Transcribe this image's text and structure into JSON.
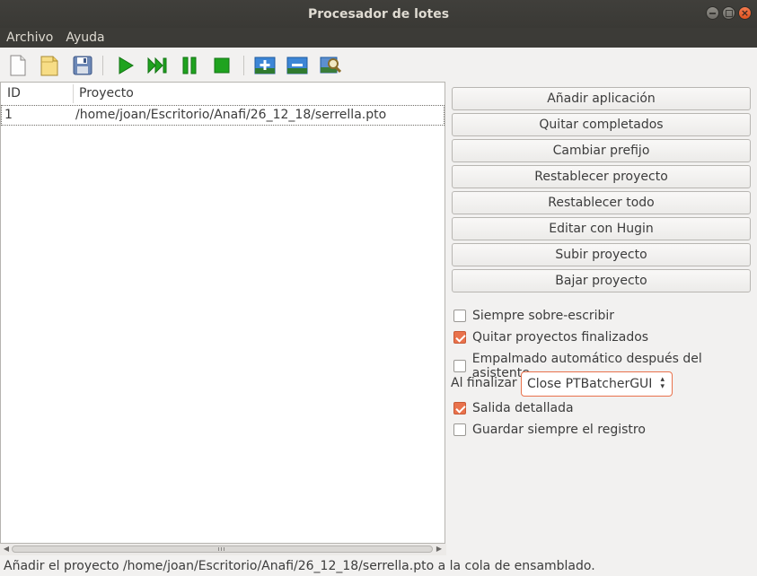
{
  "window": {
    "title": "Procesador de lotes"
  },
  "menu": [
    "Archivo",
    "Ayuda"
  ],
  "toolbar": {
    "icons": [
      "new-batch-icon",
      "open-batch-icon",
      "save-batch-icon",
      "start-icon",
      "skip-icon",
      "pause-icon",
      "stop-icon",
      "add-project-icon",
      "remove-project-icon",
      "search-projects-icon"
    ],
    "colors": {
      "play": "#1fa31f",
      "accent": "#e9724c"
    }
  },
  "table": {
    "columns": [
      "ID",
      "Proyecto"
    ],
    "rows": [
      {
        "id": "1",
        "project": "/home/joan/Escritorio/Anafi/26_12_18/serrella.pto"
      }
    ]
  },
  "buttons": [
    "Añadir aplicación",
    "Quitar completados",
    "Cambiar prefijo",
    "Restablecer proyecto",
    "Restablecer todo",
    "Editar con Hugin",
    "Subir proyecto",
    "Bajar proyecto"
  ],
  "options": {
    "overwrite": {
      "label": "Siempre sobre-escribir",
      "checked": false
    },
    "remove_finished": {
      "label": "Quitar proyectos finalizados",
      "checked": true
    },
    "auto_stitch": {
      "label": "Empalmado automático después del asistente",
      "checked": false
    },
    "on_finish": {
      "label": "Al finalizar",
      "value": "Close PTBatcherGUI"
    },
    "verbose": {
      "label": "Salida detallada",
      "checked": true
    },
    "always_log": {
      "label": "Guardar siempre el registro",
      "checked": false
    }
  },
  "status": "Añadir el proyecto /home/joan/Escritorio/Anafi/26_12_18/serrella.pto a la cola de ensamblado."
}
